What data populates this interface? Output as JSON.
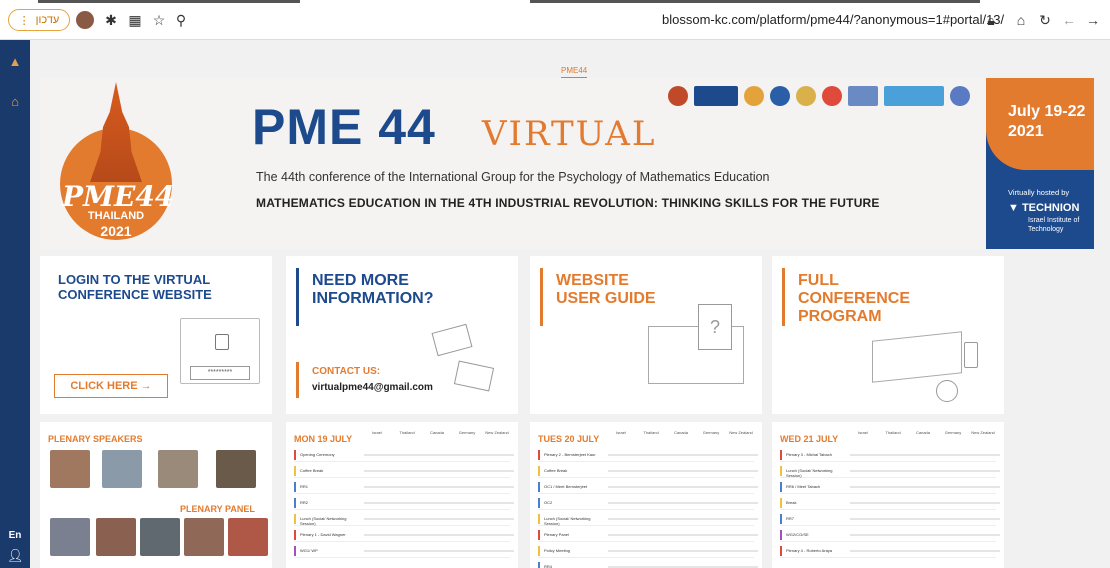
{
  "browser": {
    "update_label": "עדכון",
    "update_icon": "more-vert-icon",
    "url": "blossom-kc.com/platform/pme44/?anonymous=1#portal/13/"
  },
  "sidebar": {
    "items": [
      {
        "name": "temple-icon"
      },
      {
        "name": "home-icon"
      }
    ],
    "lang": "En",
    "user_icon": "user-icon"
  },
  "page": {
    "tag": "PME44"
  },
  "banner": {
    "logo_text": "PME44",
    "logo_country": "THAILAND",
    "logo_year": "2021",
    "title": "PME 44",
    "title_virtual": "VIRTUAL",
    "subtitle": "The 44th conference of the International Group for the Psychology of Mathematics Education",
    "theme": "MATHEMATICS EDUCATION IN THE 4TH INDUSTRIAL REVOLUTION: THINKING SKILLS FOR THE FUTURE",
    "dates": "July 19-22",
    "year": "2021",
    "hosted_by": "Virtually hosted by",
    "host": "TECHNION",
    "host_sub": "Israel Institute of Technology"
  },
  "cards": {
    "login": {
      "title": "LOGIN TO THE VIRTUAL CONFERENCE WEBSITE",
      "password": "*********",
      "button": "CLICK HERE →"
    },
    "info": {
      "title": "NEED MORE INFORMATION?",
      "contact_label": "CONTACT US:",
      "email": "virtualpme44@gmail.com"
    },
    "guide": {
      "title": "WEBSITE USER GUIDE",
      "question_mark": "?"
    },
    "program": {
      "title": "FULL CONFERENCE PROGRAM"
    }
  },
  "speakers": {
    "plenary_speakers": "PLENARY SPEAKERS",
    "plenary_panel": "PLENARY PANEL"
  },
  "schedule": {
    "timezones": [
      "Israel",
      "Thailand",
      "Canada",
      "Germany",
      "New Zealand"
    ],
    "days": [
      {
        "title": "MON 19 JULY",
        "rows": [
          {
            "name": "Opening Ceremony",
            "color": "#e04a3a"
          },
          {
            "name": "Coffee Break",
            "color": "#f0c040"
          },
          {
            "name": "RR1",
            "color": "#4a7fd0"
          },
          {
            "name": "RR2",
            "color": "#4a7fd0"
          },
          {
            "name": "Lunch (Social/ Networking Session)",
            "color": "#f0c040"
          },
          {
            "name": "Plenary 1 - David Wagner",
            "color": "#e04a3a"
          },
          {
            "name": "WG1/ WP",
            "color": "#a050c0"
          }
        ]
      },
      {
        "title": "TUES 20 JULY",
        "rows": [
          {
            "name": "Plenary 2 - Bernsterjeet Kaur",
            "color": "#e04a3a"
          },
          {
            "name": "Coffee Break",
            "color": "#f0c040"
          },
          {
            "name": "OC1 / Meet Bernsterjeet",
            "color": "#4a7fd0"
          },
          {
            "name": "OC2",
            "color": "#4a7fd0"
          },
          {
            "name": "Lunch (Social/ Networking Session)",
            "color": "#f0c040"
          },
          {
            "name": "Plenary Panel",
            "color": "#e04a3a"
          },
          {
            "name": "Policy Meeting",
            "color": "#f0c040"
          },
          {
            "name": "RR4",
            "color": "#4a7fd0"
          }
        ]
      },
      {
        "title": "WED 21 JULY",
        "rows": [
          {
            "name": "Plenary 3 - Michal Tabach",
            "color": "#e04a3a"
          },
          {
            "name": "Lunch (Social/ Networking Session)",
            "color": "#f0c040"
          },
          {
            "name": "RR6 / Meet Tabach",
            "color": "#4a7fd0"
          },
          {
            "name": "Break",
            "color": "#f0c040"
          },
          {
            "name": "RR7",
            "color": "#4a7fd0"
          },
          {
            "name": "WG2/CG/SE",
            "color": "#a050c0"
          },
          {
            "name": "Plenary 4 - Roberto Araya",
            "color": "#e04a3a"
          }
        ]
      }
    ]
  },
  "colors": {
    "navy": "#1d4a8c",
    "orange": "#e37b2f"
  }
}
